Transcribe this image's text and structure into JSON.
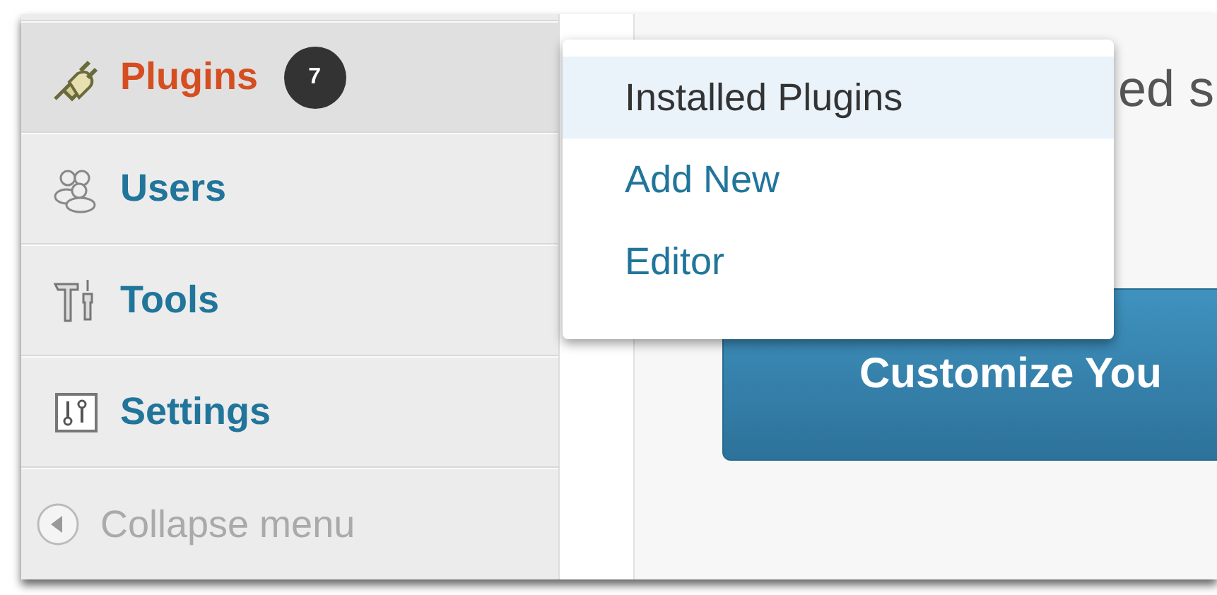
{
  "sidebar": {
    "items": [
      {
        "label": "Plugins",
        "kind": "plug",
        "selected": true,
        "badge": "7"
      },
      {
        "label": "Users",
        "kind": "users",
        "selected": false
      },
      {
        "label": "Tools",
        "kind": "tools",
        "selected": false
      },
      {
        "label": "Settings",
        "kind": "settings",
        "selected": false
      }
    ],
    "collapse": {
      "label": "Collapse menu"
    }
  },
  "submenu": {
    "items": [
      {
        "label": "Installed Plugins",
        "selected": true
      },
      {
        "label": "Add New",
        "selected": false
      },
      {
        "label": "Editor",
        "selected": false
      }
    ]
  },
  "content": {
    "partial_text": "ed s",
    "button": "Customize You"
  }
}
